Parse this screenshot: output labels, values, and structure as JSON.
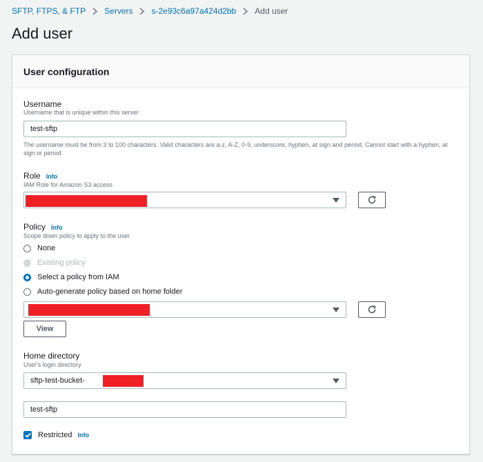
{
  "breadcrumb": {
    "items": [
      "SFTP, FTPS, & FTP",
      "Servers",
      "s-2e93c6a97a424d2bb"
    ],
    "current": "Add user"
  },
  "page": {
    "title": "Add user"
  },
  "panel": {
    "title": "User configuration"
  },
  "username": {
    "label": "Username",
    "description": "Username that is unique within this server",
    "value": "test-sftp",
    "constraint": "The username must be from 3 to 100 characters. Valid characters are a-z, A-Z, 0-9, underscore, hyphen, at sign and period. Cannot start with a hyphen, at sign or period."
  },
  "role": {
    "label": "Role",
    "info": "Info",
    "description": "IAM Role for Amazon S3 access"
  },
  "policy": {
    "label": "Policy",
    "info": "Info",
    "description": "Scope down policy to apply to the user",
    "options": [
      "None",
      "Existing policy",
      "Select a policy from IAM",
      "Auto-generate policy based on home folder"
    ],
    "selected": "Select a policy from IAM",
    "view_button": "View"
  },
  "home_directory": {
    "label": "Home directory",
    "description": "User's login directory",
    "bucket_value": "sftp-test-bucket-",
    "folder_value": "test-sftp"
  },
  "restricted": {
    "label": "Restricted",
    "info": "Info",
    "checked": true
  },
  "colors": {
    "link": "#0073bb",
    "redaction": "#ee1f25",
    "background": "#f2f3f3"
  }
}
